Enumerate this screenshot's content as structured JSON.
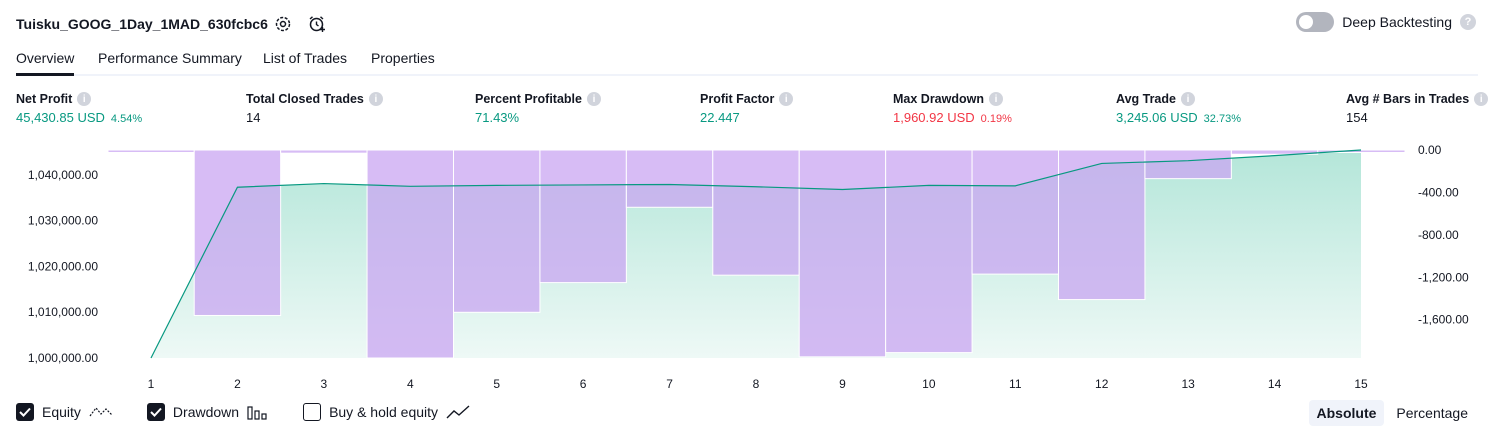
{
  "header": {
    "title": "Tuisku_GOOG_1Day_1MAD_630fcbc6",
    "deep_backtesting_label": "Deep Backtesting",
    "help_glyph": "?"
  },
  "tabs": [
    {
      "label": "Overview",
      "active": true
    },
    {
      "label": "Performance Summary",
      "active": false
    },
    {
      "label": "List of Trades",
      "active": false
    },
    {
      "label": "Properties",
      "active": false
    }
  ],
  "info_glyph": "i",
  "stats": {
    "net_profit": {
      "label": "Net Profit",
      "value": "45,430.85 USD",
      "pct": "4.54%"
    },
    "total_closed_trades": {
      "label": "Total Closed Trades",
      "value": "14"
    },
    "percent_profitable": {
      "label": "Percent Profitable",
      "value": "71.43%"
    },
    "profit_factor": {
      "label": "Profit Factor",
      "value": "22.447"
    },
    "max_drawdown": {
      "label": "Max Drawdown",
      "value": "1,960.92 USD",
      "pct": "0.19%"
    },
    "avg_trade": {
      "label": "Avg Trade",
      "value": "3,245.06 USD",
      "pct": "32.73%"
    },
    "avg_bars": {
      "label": "Avg # Bars in Trades",
      "value": "154"
    }
  },
  "chart_data": {
    "type": "line",
    "x": [
      1,
      2,
      3,
      4,
      5,
      6,
      7,
      8,
      9,
      10,
      11,
      12,
      13,
      14,
      15
    ],
    "series": [
      {
        "name": "Equity",
        "type": "area",
        "axis": "left",
        "color": "#089981",
        "values": [
          1000000,
          1037300,
          1038100,
          1037500,
          1037700,
          1037800,
          1037900,
          1037400,
          1036800,
          1037700,
          1037600,
          1042500,
          1043100,
          1044200,
          1045430.85
        ]
      },
      {
        "name": "Drawdown",
        "type": "bar",
        "axis": "right",
        "color": "#c9a6f2",
        "values": [
          0,
          -1560,
          -30,
          -1960.92,
          -1530,
          -1250,
          -540,
          -1180,
          -1950,
          -1910,
          -1170,
          -1410,
          -270,
          -40,
          0
        ]
      }
    ],
    "left_axis": {
      "ticks": [
        "1,000,000.00",
        "1,010,000.00",
        "1,020,000.00",
        "1,030,000.00",
        "1,040,000.00"
      ],
      "tick_values": [
        1000000,
        1010000,
        1020000,
        1030000,
        1040000
      ],
      "ylim": [
        1000000,
        1045430.85
      ]
    },
    "right_axis": {
      "ticks": [
        "0.00",
        "-400.00",
        "-800.00",
        "-1,200.00",
        "-1,600.00"
      ],
      "tick_values": [
        0,
        -400,
        -800,
        -1200,
        -1600
      ],
      "ylim": [
        -1960.92,
        0
      ]
    },
    "x_ticks": [
      "1",
      "2",
      "3",
      "4",
      "5",
      "6",
      "7",
      "8",
      "9",
      "10",
      "11",
      "12",
      "13",
      "14",
      "15"
    ],
    "grid": false
  },
  "legend": {
    "equity": {
      "label": "Equity",
      "checked": true
    },
    "drawdown": {
      "label": "Drawdown",
      "checked": true
    },
    "buy_hold": {
      "label": "Buy & hold equity",
      "checked": false
    }
  },
  "modes": {
    "absolute": "Absolute",
    "percentage": "Percentage",
    "active": "absolute"
  }
}
